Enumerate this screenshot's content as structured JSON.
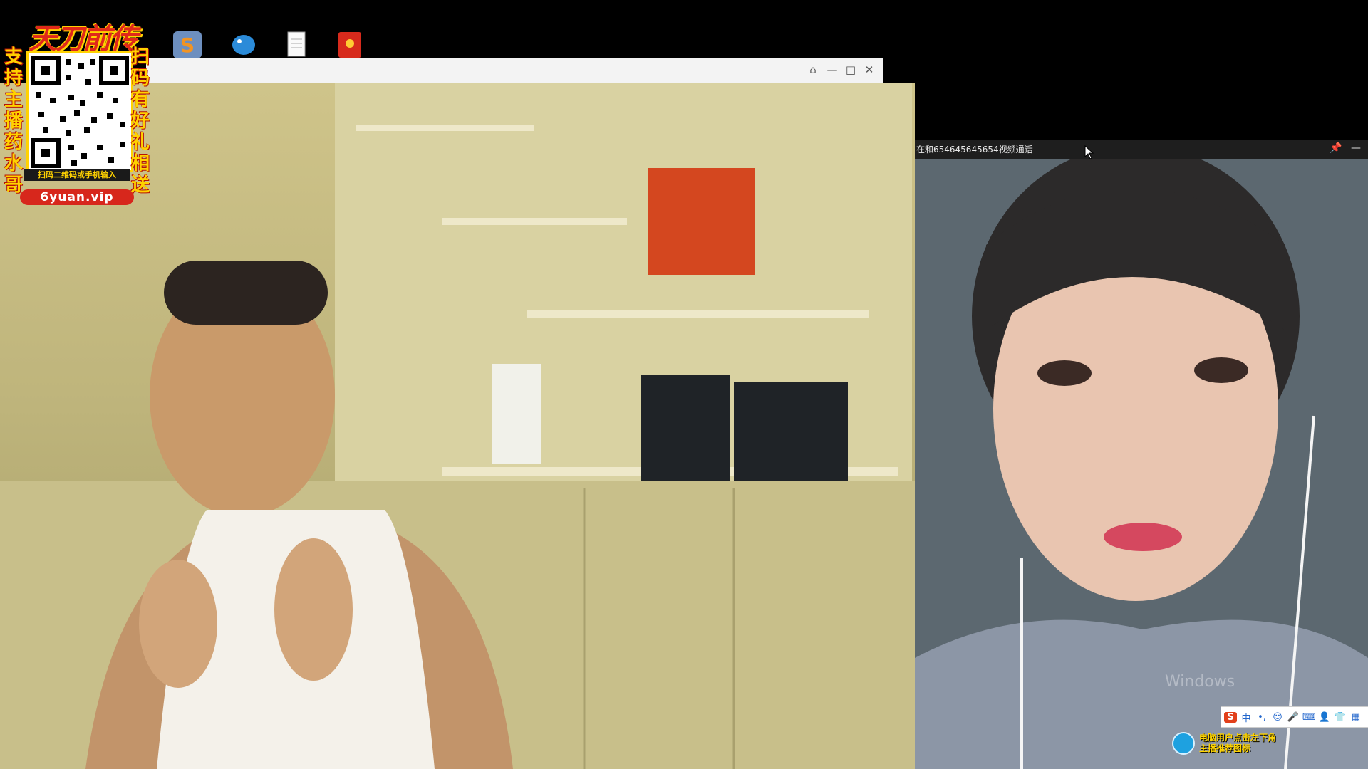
{
  "ad": {
    "brand": "天刀前传",
    "left_text": "支持主播药水哥",
    "right_text": "扫码有好礼相送",
    "scan_hint": "扫码二维码或手机输入",
    "url": "6yuan.vip"
  },
  "desktop_icons": [
    "sogou-icon",
    "bird-icon",
    "document-icon",
    "redpacket-icon"
  ],
  "left_window": {
    "titlebar_buttons": [
      "skin",
      "minimize",
      "maximize",
      "close"
    ]
  },
  "video_call": {
    "title": "在和6546456456​54视频通话"
  },
  "ime_bar": {
    "logo": "S",
    "mode": "中",
    "items": [
      "•,",
      "☺",
      "🎤",
      "⌨",
      "👤",
      "👕",
      "▦"
    ]
  },
  "notice": {
    "line1": "电脑用户点击左下角",
    "line2": "主播推荐图标"
  },
  "watermark": "Windows",
  "colors": {
    "ad_red": "#d7271c",
    "ad_yellow": "#ffd200",
    "call_bar": "#1e1e1e"
  }
}
